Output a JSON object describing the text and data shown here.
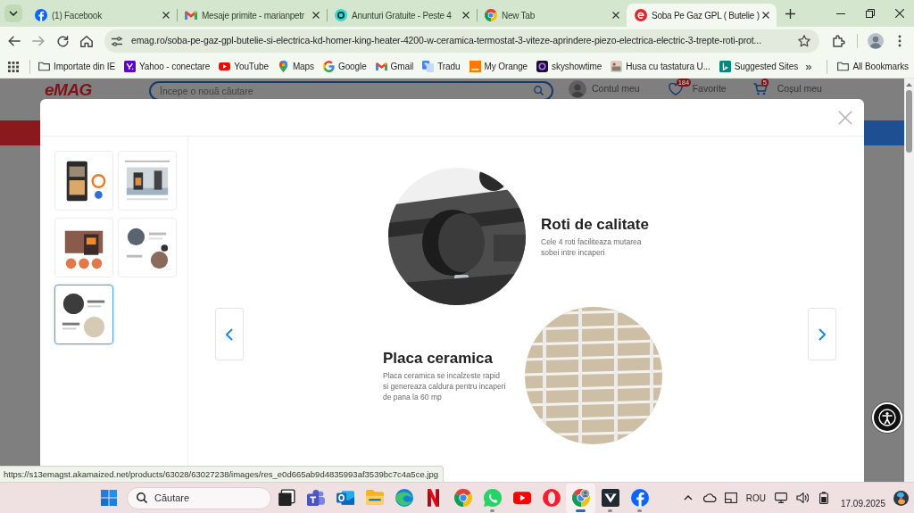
{
  "browser": {
    "tabs": [
      {
        "kind": "facebook",
        "title": "(1) Facebook",
        "selected": false
      },
      {
        "kind": "gmail",
        "title": "Mesaje primite - marianpetr",
        "selected": false
      },
      {
        "kind": "olx",
        "title": "Anunturi Gratuite - Peste 4",
        "selected": false
      },
      {
        "kind": "chrome",
        "title": "New Tab",
        "selected": false
      },
      {
        "kind": "emag",
        "title": "Soba Pe Gaz GPL ( Butelie )",
        "selected": true
      }
    ],
    "address_bar": {
      "url": "emag.ro/soba-pe-gaz-gpl-butelie-si-electrica-kd-homer-king-heater-4200-w-ceramica-termostat-3-viteze-aprindere-piezo-electrica-electric-3-trepte-roti-prot..."
    },
    "bookmarks": [
      {
        "kind": "folder",
        "label": "Importate din IE"
      },
      {
        "kind": "yahoo",
        "label": "Yahoo - conectare"
      },
      {
        "kind": "youtube",
        "label": "YouTube"
      },
      {
        "kind": "maps",
        "label": "Maps"
      },
      {
        "kind": "google",
        "label": "Google"
      },
      {
        "kind": "gmail",
        "label": "Gmail"
      },
      {
        "kind": "translate",
        "label": "Tradu"
      },
      {
        "kind": "orange",
        "label": "My Orange"
      },
      {
        "kind": "skyshowtime",
        "label": "skyshowtime"
      },
      {
        "kind": "picture",
        "label": "Husa cu tastatura U..."
      },
      {
        "kind": "bing",
        "label": "Suggested Sites"
      }
    ],
    "bookmarks_more": "»",
    "all_bookmarks": "All Bookmarks",
    "status_url": "https://s13emagst.akamaized.net/products/63028/63027238/images/res_e0d665ab9d4835993af3539bc7c4a5ce.jpg"
  },
  "page": {
    "logo": "eMAG",
    "search": {
      "placeholder": "Începe o nouă căutare"
    },
    "account": "Contul meu",
    "favorites": {
      "label": "Favorite",
      "count": "184"
    },
    "cart": {
      "label": "Coșul meu",
      "count": "5"
    }
  },
  "gallery": {
    "thumbnails": [
      {
        "kind": "heater",
        "selected": false
      },
      {
        "kind": "room",
        "selected": false
      },
      {
        "kind": "fire",
        "selected": false
      },
      {
        "kind": "collage",
        "selected": false
      },
      {
        "kind": "infographic",
        "selected": true
      }
    ],
    "image": {
      "sections": [
        {
          "kind": "wheel",
          "title": "Roti de calitate",
          "lines": [
            "Cele 4 roti faciliteaza mutarea",
            "sobei intre incaperi"
          ]
        },
        {
          "kind": "grille",
          "title": "Placa ceramica",
          "lines": [
            "Placa ceramica se incalzeste rapid",
            "si genereaza caldura pentru incaperi",
            "de pana la 60 mp"
          ]
        }
      ]
    }
  },
  "taskbar": {
    "search": {
      "placeholder": "Căutare"
    },
    "apps": [
      {
        "kind": "stack",
        "running": false,
        "selected": false
      },
      {
        "kind": "teams",
        "running": false,
        "selected": false
      },
      {
        "kind": "outlook",
        "running": false,
        "selected": false
      },
      {
        "kind": "explorer",
        "running": false,
        "selected": false
      },
      {
        "kind": "edge",
        "running": false,
        "selected": false
      },
      {
        "kind": "netflix",
        "running": false,
        "selected": false
      },
      {
        "kind": "chrome",
        "running": false,
        "selected": false
      },
      {
        "kind": "whatsapp",
        "running": true,
        "selected": false
      },
      {
        "kind": "youtube",
        "running": false,
        "selected": false
      },
      {
        "kind": "opera",
        "running": false,
        "selected": false
      },
      {
        "kind": "chrome-profile",
        "running": true,
        "selected": true
      },
      {
        "kind": "vector",
        "running": true,
        "selected": false
      },
      {
        "kind": "facebook",
        "running": true,
        "selected": false
      }
    ],
    "tray": {
      "language": "ROU",
      "date": "17.09.2025"
    }
  }
}
